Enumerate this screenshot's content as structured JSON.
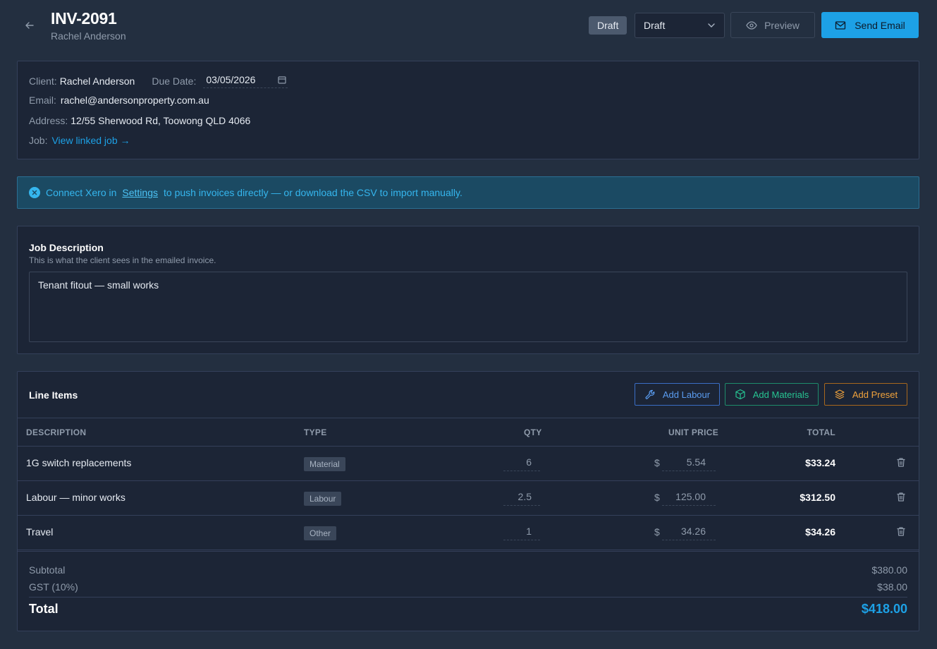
{
  "header": {
    "title": "INV-2091",
    "subtitle": "Rachel Anderson",
    "status_badge": "Draft",
    "status_select": "Draft",
    "preview_label": "Preview",
    "send_label": "Send Email"
  },
  "info": {
    "client_label": "Client:",
    "client_value": "Rachel Anderson",
    "due_label": "Due Date:",
    "due_value": "03/05/2026",
    "email_label": "Email:",
    "email_value": "rachel@andersonproperty.com.au",
    "address_label": "Address:",
    "address_value": "12/55 Sherwood Rd, Toowong QLD 4066",
    "job_label": "Job:",
    "job_link": "View linked job →"
  },
  "alert": {
    "prefix": "Connect Xero in",
    "settings_link": "Settings",
    "suffix": "to push invoices directly — or download the CSV to import manually."
  },
  "description": {
    "title": "Job Description",
    "hint": "This is what the client sees in the emailed invoice.",
    "value": "Tenant fitout — small works"
  },
  "line_items": {
    "title": "Line Items",
    "add_labour": "Add Labour",
    "add_materials": "Add Materials",
    "add_preset": "Add Preset",
    "columns": {
      "description": "DESCRIPTION",
      "type": "TYPE",
      "qty": "QTY",
      "unit_price": "UNIT PRICE",
      "total": "TOTAL"
    },
    "currency_symbol": "$",
    "rows": [
      {
        "description": "1G switch replacements",
        "type": "Material",
        "qty": "6",
        "unit_price": "5.54",
        "total": "$33.24"
      },
      {
        "description": "Labour — minor works",
        "type": "Labour",
        "qty": "2.5",
        "unit_price": "125.00",
        "total": "$312.50"
      },
      {
        "description": "Travel",
        "type": "Other",
        "qty": "1",
        "unit_price": "34.26",
        "total": "$34.26"
      }
    ]
  },
  "summary": {
    "subtotal_label": "Subtotal",
    "subtotal_value": "$380.00",
    "gst_label": "GST (10%)",
    "gst_value": "$38.00",
    "total_label": "Total",
    "total_value": "$418.00"
  },
  "colors": {
    "accent": "#1da1e6",
    "background": "#232f40",
    "card": "#1c2536",
    "labour": "#5a9cf0",
    "materials": "#27c492",
    "preset": "#f0a23c"
  }
}
